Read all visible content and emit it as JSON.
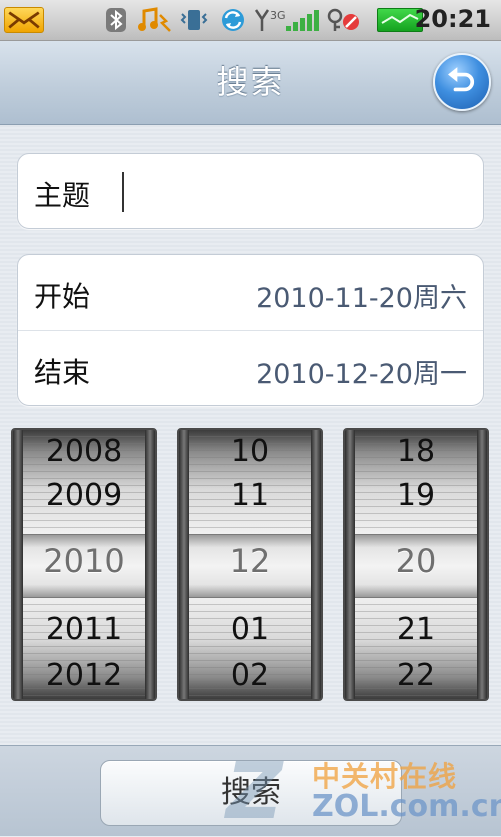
{
  "status_bar": {
    "time": "20:21",
    "icons": [
      "mail-icon",
      "bluetooth-icon",
      "music-icon",
      "vibrate-icon",
      "sync-icon",
      "signal-3g-icon",
      "alarm-icon",
      "battery-icon"
    ]
  },
  "header": {
    "title": "搜索",
    "back_icon": "back-arrow-icon"
  },
  "subject": {
    "label": "主题",
    "value": ""
  },
  "dates": {
    "start_label": "开始",
    "start_value": "2010-11-20周六",
    "end_label": "结束",
    "end_value": "2010-12-20周一"
  },
  "pickers": {
    "year": [
      "2008",
      "2009",
      "2010",
      "2011",
      "2012"
    ],
    "month": [
      "10",
      "11",
      "12",
      "01",
      "02"
    ],
    "day": [
      "18",
      "19",
      "20",
      "21",
      "22"
    ]
  },
  "footer": {
    "search_label": "搜索"
  },
  "watermark": {
    "cn": "中关村在线",
    "en": "ZOL.com.cn"
  },
  "colors": {
    "accent_blue": "#3f8fe0",
    "value_text": "#4a5a73",
    "battery_green": "#14a21f"
  }
}
